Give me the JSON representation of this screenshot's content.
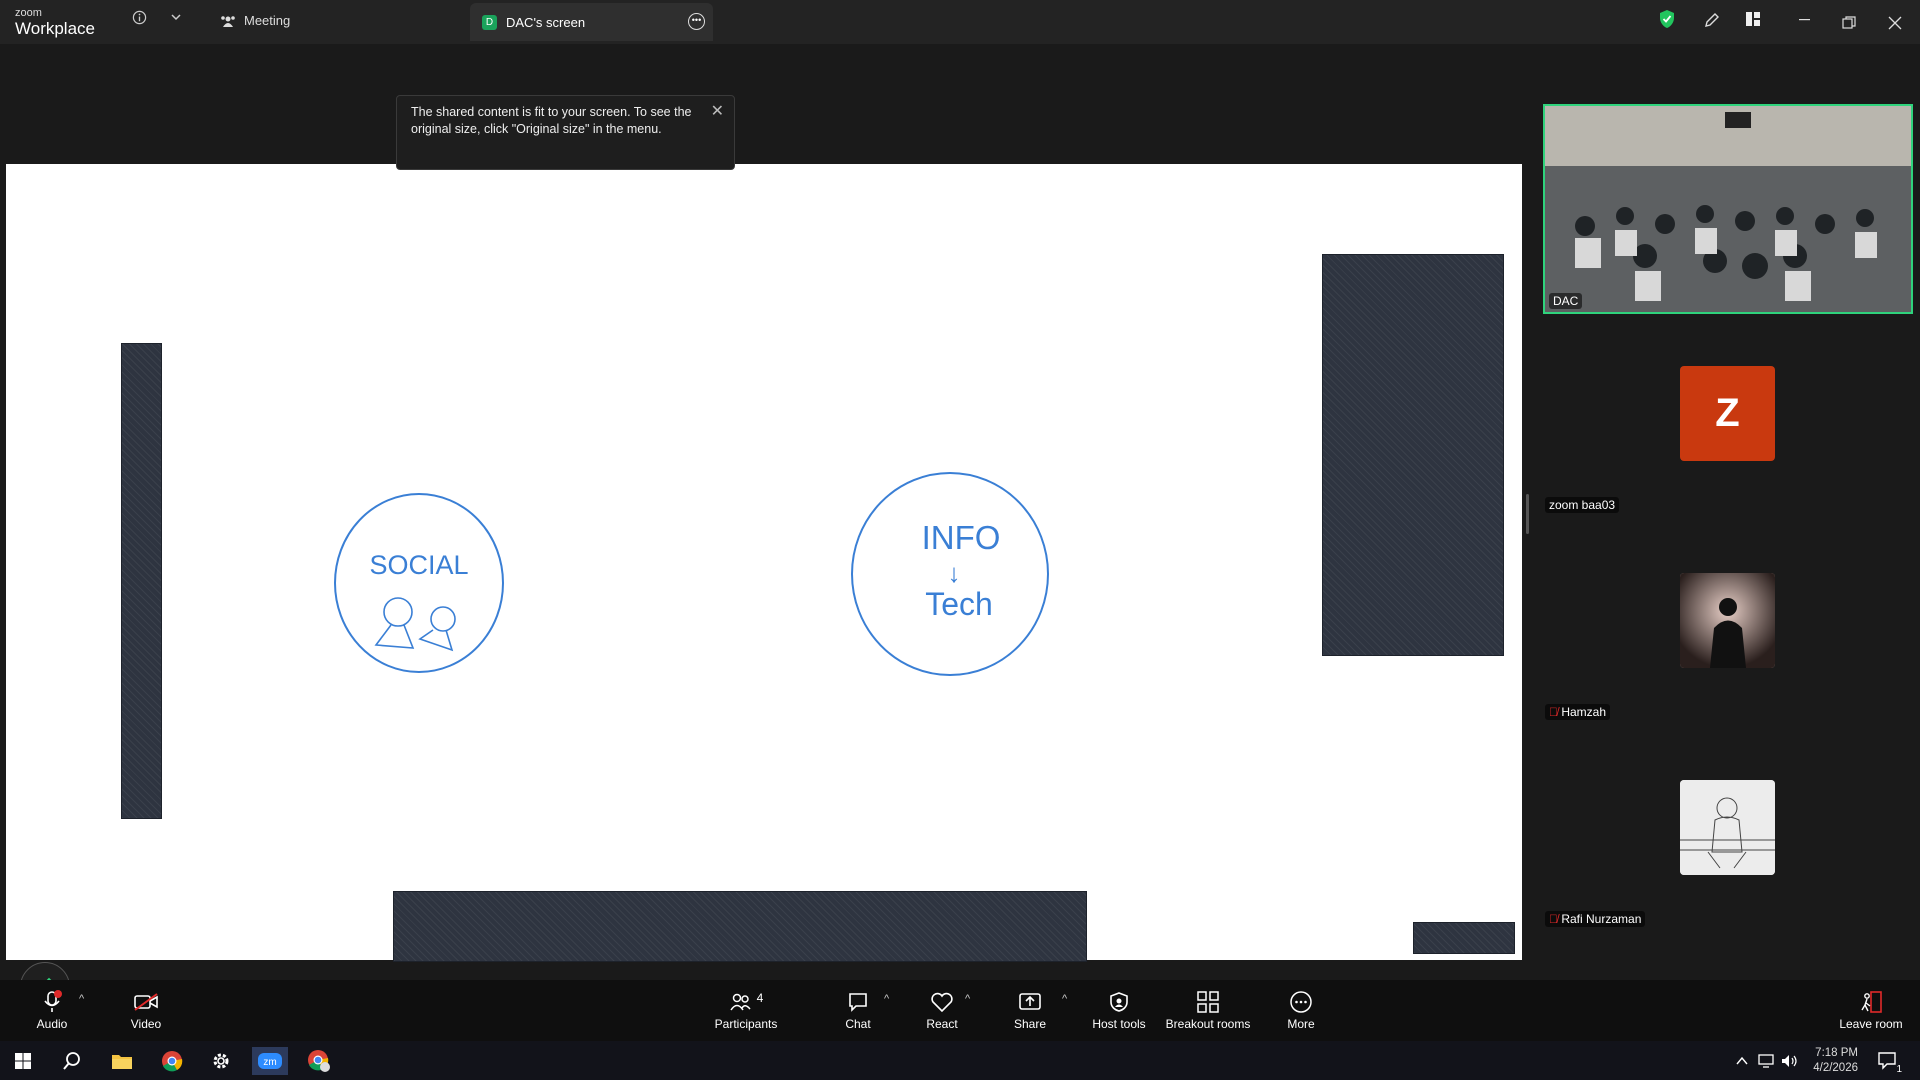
{
  "app": {
    "logo_small": "zoom",
    "logo_big": "Workplace",
    "meeting_label": "Meeting",
    "share_tab_badge": "D",
    "share_tab_label": "DAC's screen"
  },
  "tooltip": {
    "message": "The shared content is fit to your screen. To see the original size, click \"Original size\" in the menu."
  },
  "whiteboard": {
    "circle1_text": "SOCIAL",
    "circle2_line1": "INFO",
    "circle2_arrow": "↓",
    "circle2_line2": "Tech",
    "stroke_color": "#3a7fd5"
  },
  "participants_panel": {
    "tiles": [
      {
        "name": "DAC",
        "type": "video"
      },
      {
        "name": "zoom baa03",
        "initial": "Z",
        "avatar_color": "#c9390f"
      },
      {
        "name": "Hamzah",
        "muted": true
      },
      {
        "name": "Rafi Nurzaman",
        "muted": true
      }
    ]
  },
  "toolbar": {
    "audio": "Audio",
    "video": "Video",
    "participants": "Participants",
    "participants_count": "4",
    "chat": "Chat",
    "react": "React",
    "share": "Share",
    "host_tools": "Host tools",
    "breakout_rooms": "Breakout rooms",
    "more": "More",
    "leave_room": "Leave room"
  },
  "taskbar": {
    "time": "7:18 PM",
    "date": "4/2/2026",
    "notification_count": "1"
  },
  "colors": {
    "accent_green": "#2fd37c",
    "share_badge": "#1aa35b",
    "leave_red": "#e02a2a"
  }
}
